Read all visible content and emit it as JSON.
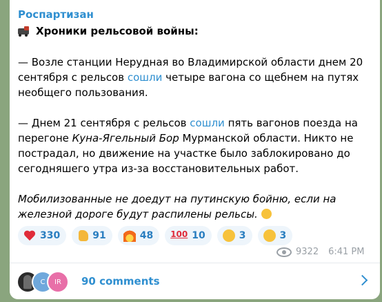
{
  "post": {
    "channel": "Роспартизан",
    "title": "Хроники рельсовой войны:",
    "p1": {
      "a": "— Возле станции Нерудная во Владимирской области днем 20 сентября с рельсов ",
      "link": "сошли",
      "b": " четыре вагона со щебнем на путях необщего пользования."
    },
    "p2": {
      "a": "— Днем 21 сентября с рельсов ",
      "link": "сошли",
      "b": " пять вагонов поезда на перегоне ",
      "i": "Куна-Ягельный Бор",
      "c": " Мурманской области. Никто не пострадал, но движение на участке было заблокировано до сегодняшего утра из-за восстановительных работ."
    },
    "p3": "Мобилизованные не доедут на путинскую бойню, если на железной дороге будут распилены рельсы."
  },
  "reactions": [
    {
      "icon": "heart-icon",
      "count": "330"
    },
    {
      "icon": "thumbs-up-icon",
      "count": "91"
    },
    {
      "icon": "fire-icon",
      "count": "48"
    },
    {
      "icon": "hundred-icon",
      "count": "10"
    },
    {
      "icon": "star-struck-icon",
      "count": "3"
    },
    {
      "icon": "rofl-icon",
      "count": "3"
    }
  ],
  "meta": {
    "views": "9322",
    "time": "6:41 PM"
  },
  "comments": {
    "avatars": [
      "C",
      "IR"
    ],
    "label": "90 comments"
  },
  "colors": {
    "accent": "#2f8fd0",
    "background": "#8aa57e",
    "reaction_bg": "#eef5fb"
  }
}
